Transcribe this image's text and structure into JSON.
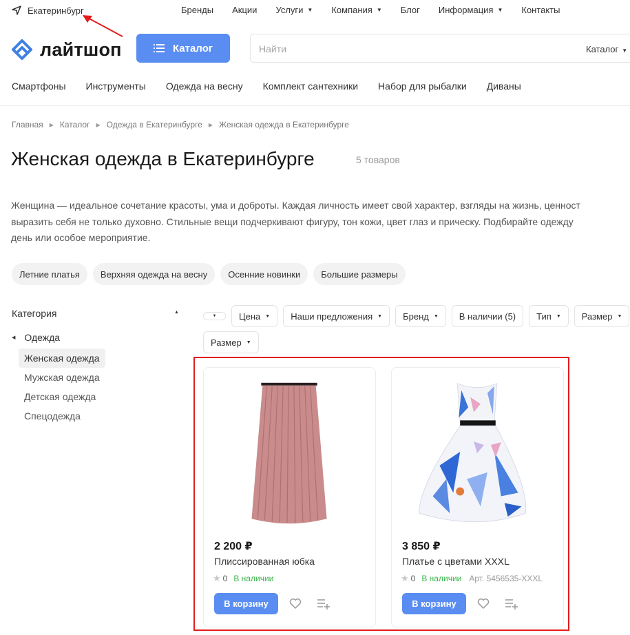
{
  "topbar": {
    "city": "Екатеринбург",
    "nav": [
      {
        "label": "Бренды",
        "has_menu": false
      },
      {
        "label": "Акции",
        "has_menu": false
      },
      {
        "label": "Услуги",
        "has_menu": true
      },
      {
        "label": "Компания",
        "has_menu": true
      },
      {
        "label": "Блог",
        "has_menu": false
      },
      {
        "label": "Информация",
        "has_menu": true
      },
      {
        "label": "Контакты",
        "has_menu": false
      }
    ]
  },
  "header": {
    "logo_text": "лайтшоп",
    "catalog_label": "Каталог",
    "search_placeholder": "Найти",
    "search_scope": "Каталог"
  },
  "catnav": [
    "Смартфоны",
    "Инструменты",
    "Одежда на весну",
    "Комплект сантехники",
    "Набор для рыбалки",
    "Диваны"
  ],
  "breadcrumb": [
    "Главная",
    "Каталог",
    "Одежда в Екатеринбурге",
    "Женская одежда в Екатеринбурге"
  ],
  "page": {
    "title": "Женская одежда в Екатеринбурге",
    "count": "5 товаров",
    "description": [
      "Женщина — идеальное сочетание красоты, ума и доброты. Каждая личность имеет свой характер, взгляды на жизнь, ценност",
      "выразить себя не только духовно. Стильные вещи подчеркивают фигуру, тон кожи, цвет глаз и прическу. Подбирайте одежду",
      "день или особое мероприятие."
    ]
  },
  "tags": [
    "Летние платья",
    "Верхняя одежда на весну",
    "Осенние новинки",
    "Большие размеры"
  ],
  "sidebar": {
    "title": "Категория",
    "group": "Одежда",
    "items": [
      {
        "label": "Женская одежда",
        "active": true
      },
      {
        "label": "Мужская одежда",
        "active": false
      },
      {
        "label": "Детская одежда",
        "active": false
      },
      {
        "label": "Спецодежда",
        "active": false
      }
    ]
  },
  "filters": {
    "row1": [
      "Цена",
      "Наши предложения",
      "Бренд",
      "В наличии (5)",
      "Тип",
      "Размер"
    ],
    "row2": [
      "Размер"
    ]
  },
  "products": [
    {
      "price": "2 200 ₽",
      "name": "Плиссированная юбка",
      "rating": "0",
      "stock": "В наличии",
      "article": "",
      "cart_label": "В корзину",
      "image": "pleated-skirt"
    },
    {
      "price": "3 850 ₽",
      "name": "Платье с цветами XXXL",
      "rating": "0",
      "stock": "В наличии",
      "article": "Арт. 5456535-XXXL",
      "cart_label": "В корзину",
      "image": "floral-dress"
    }
  ],
  "colors": {
    "accent": "#5a8df2",
    "in_stock": "#3cb34b",
    "highlight": "#e31c1c"
  }
}
